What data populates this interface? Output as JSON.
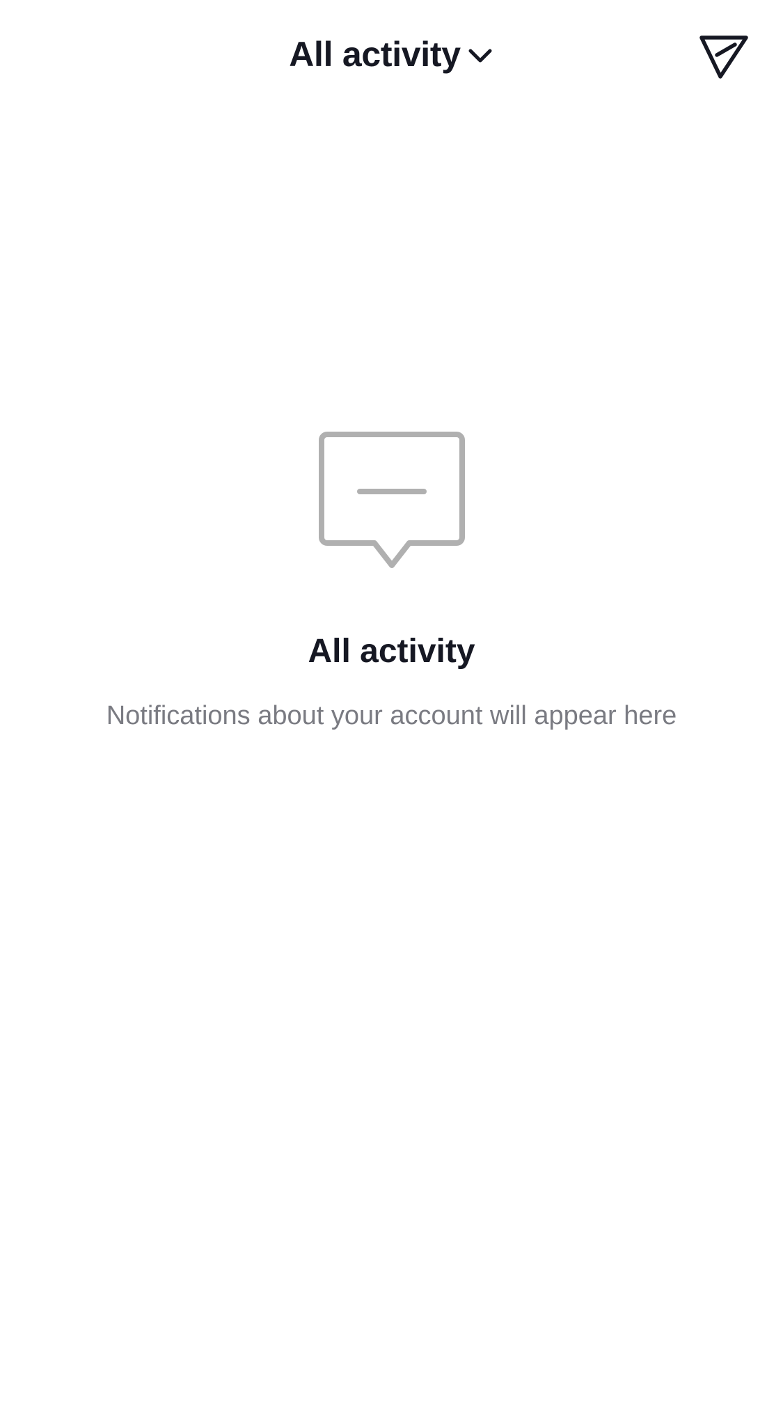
{
  "header": {
    "title": "All activity",
    "dropdown_icon": "chevron-down-icon",
    "send_icon": "paper-plane-icon"
  },
  "empty_state": {
    "icon": "message-bubble-icon",
    "title": "All activity",
    "description": "Notifications about your account will appear here"
  },
  "colors": {
    "text_primary": "#161823",
    "text_secondary": "#7a7b82",
    "icon_gray": "#b0b0b0",
    "background": "#ffffff"
  }
}
